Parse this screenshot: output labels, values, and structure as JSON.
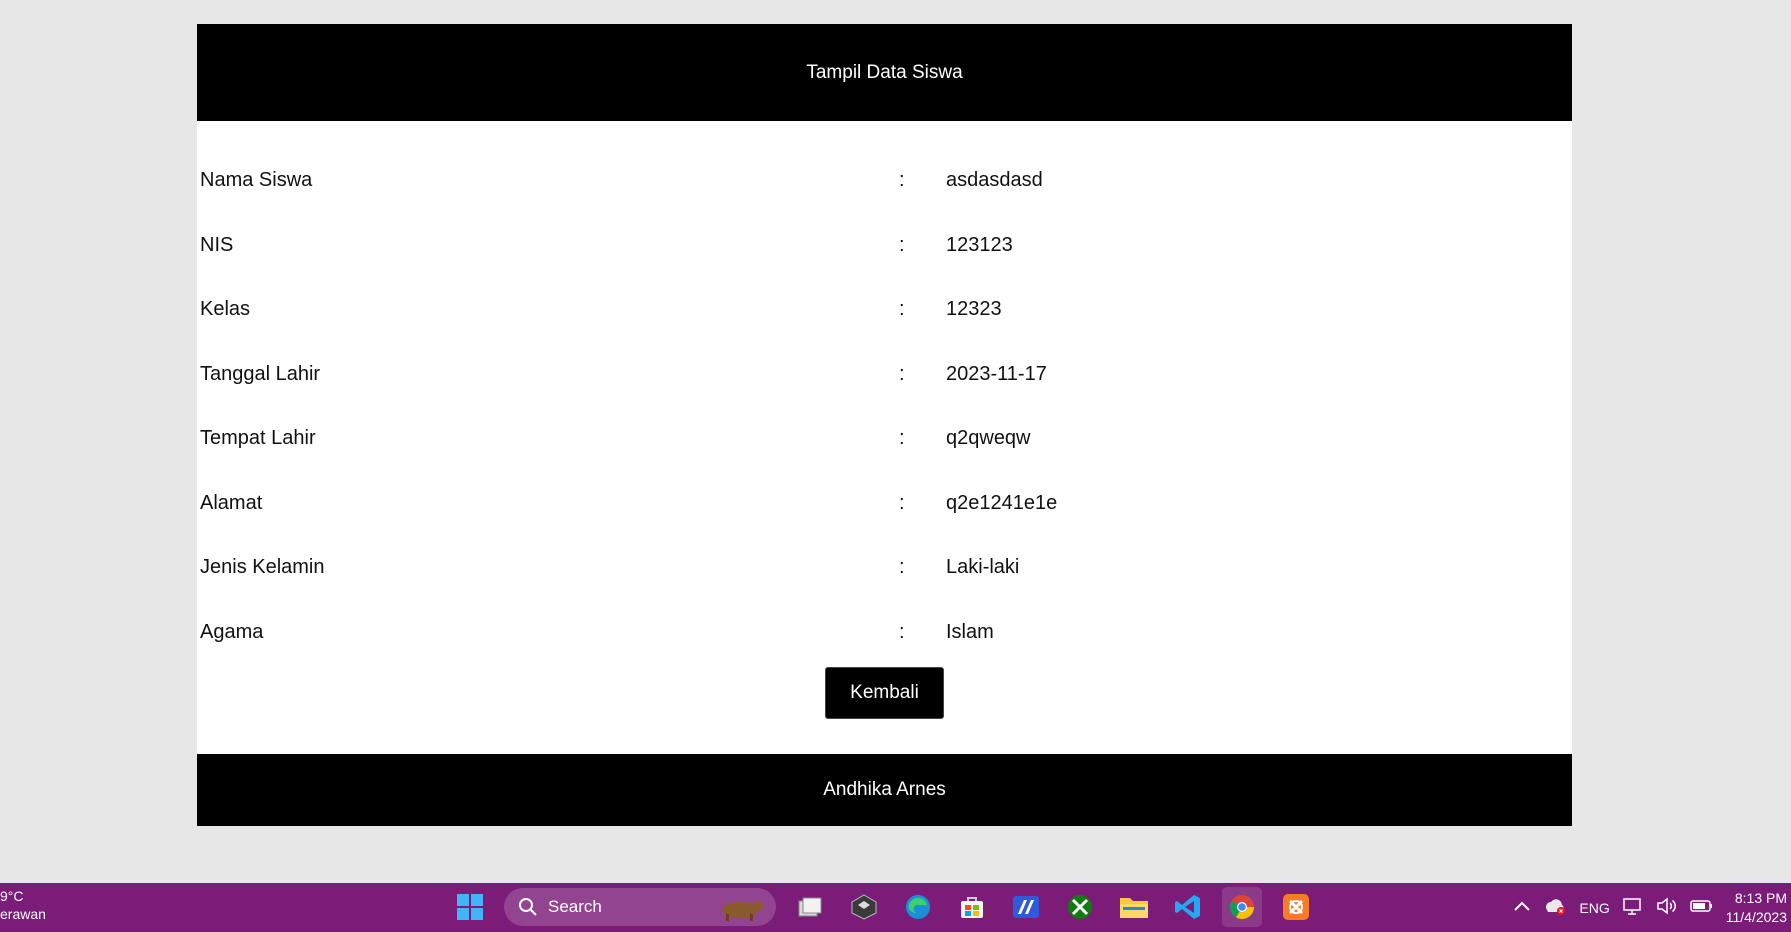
{
  "header": {
    "title": "Tampil Data Siswa"
  },
  "fields": [
    {
      "label": "Nama Siswa",
      "sep": ":",
      "value": "asdasdasd"
    },
    {
      "label": "NIS",
      "sep": ":",
      "value": "123123"
    },
    {
      "label": "Kelas",
      "sep": ":",
      "value": "12323"
    },
    {
      "label": "Tanggal Lahir",
      "sep": ":",
      "value": "2023-11-17"
    },
    {
      "label": "Tempat Lahir",
      "sep": ":",
      "value": "q2qweqw"
    },
    {
      "label": "Alamat",
      "sep": ":",
      "value": "q2e1241e1e"
    },
    {
      "label": "Jenis Kelamin",
      "sep": ":",
      "value": "Laki-laki"
    },
    {
      "label": "Agama",
      "sep": ":",
      "value": "Islam"
    }
  ],
  "back_button": {
    "label": "Kembali"
  },
  "footer": {
    "text": "Andhika Arnes"
  },
  "taskbar": {
    "weather_temp": "9°C",
    "weather_desc": "erawan",
    "search_label": "Search",
    "apps": [
      "windows-start-icon",
      "task-view-icon",
      "app-icon",
      "edge-icon",
      "store-icon",
      "app-icon",
      "xbox-icon",
      "file-explorer-icon",
      "vscode-icon",
      "chrome-icon",
      "xampp-icon"
    ],
    "tray_language": "ENG",
    "clock_time": "8:13 PM",
    "clock_date": "11/4/2023",
    "color": "#7a1c78"
  }
}
